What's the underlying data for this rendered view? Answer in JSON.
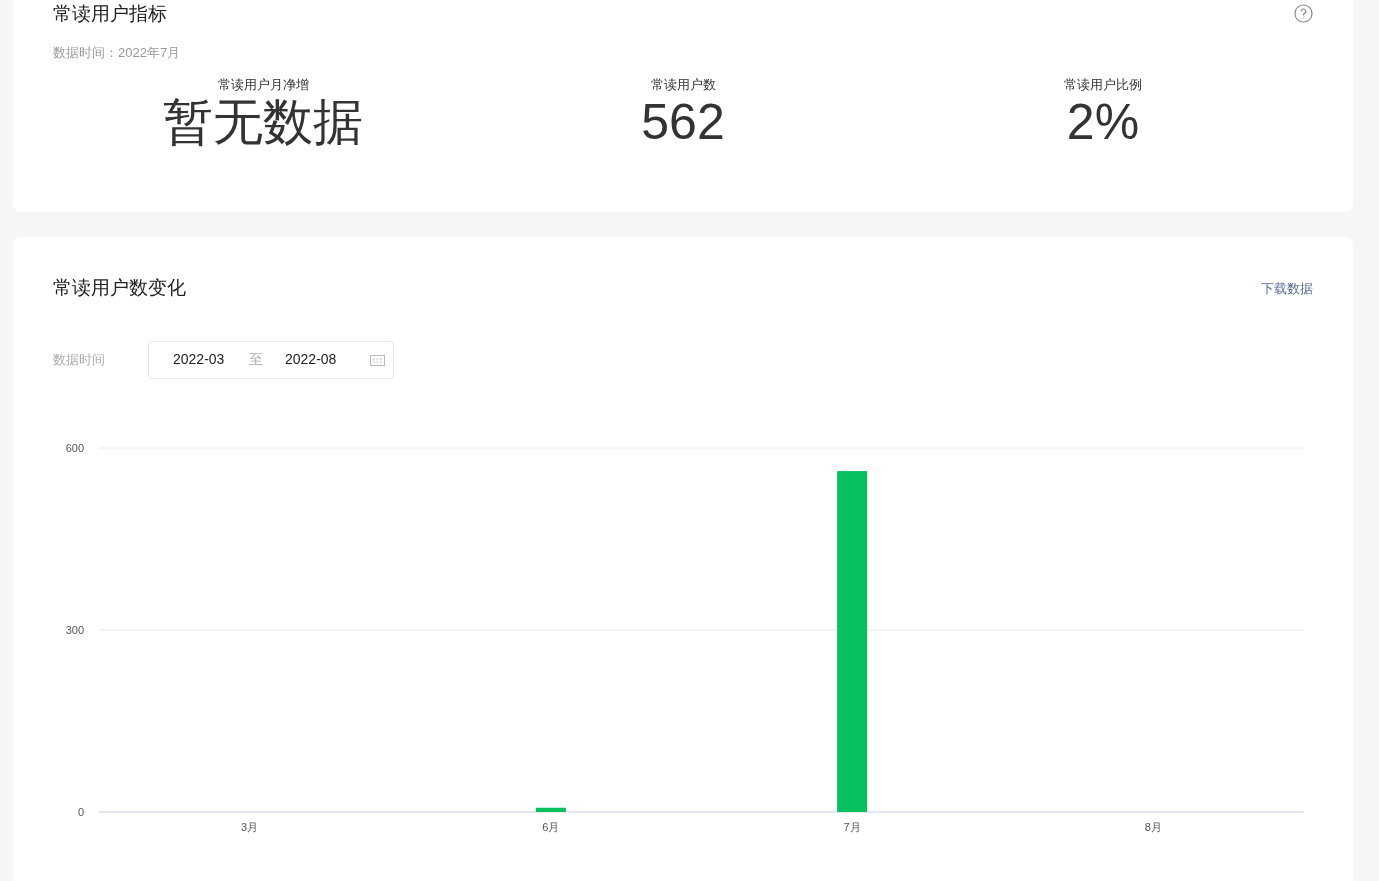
{
  "metrics_card": {
    "title": "常读用户指标",
    "data_time": "数据时间：2022年7月",
    "metrics": [
      {
        "label": "常读用户月净增",
        "value": "暂无数据"
      },
      {
        "label": "常读用户数",
        "value": "562"
      },
      {
        "label": "常读用户比例",
        "value": "2%"
      }
    ]
  },
  "trend_card": {
    "title": "常读用户数变化",
    "download_link": "下载数据",
    "date_label": "数据时间",
    "date_start": "2022-03",
    "date_separator": "至",
    "date_end": "2022-08",
    "chart_data": {
      "type": "bar",
      "categories": [
        "3月",
        "6月",
        "7月",
        "8月"
      ],
      "series": [
        {
          "color": "#07c160",
          "values": [
            0,
            7,
            562,
            0
          ]
        }
      ],
      "ylim": [
        0,
        600
      ],
      "yticks": [
        0,
        300,
        600
      ]
    }
  }
}
